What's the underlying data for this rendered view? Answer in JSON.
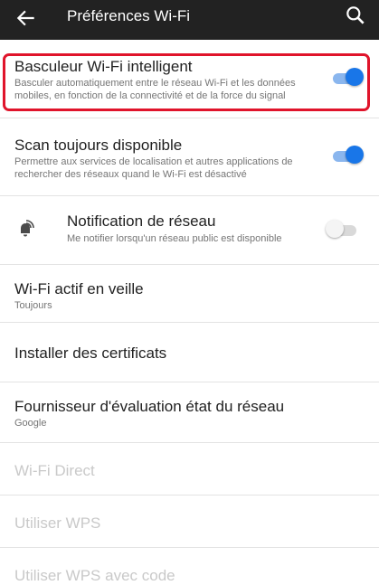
{
  "appbar": {
    "title": "Préférences Wi-Fi",
    "back_icon": "arrow-left-icon",
    "search_icon": "search-icon"
  },
  "colors": {
    "appbar": "#222222",
    "toggle_on": "#1976e8",
    "highlight": "#e0142b",
    "text_primary": "#212121",
    "text_secondary": "#757575",
    "text_disabled": "#c9c9c9"
  },
  "items": [
    {
      "title": "Basculeur Wi-Fi intelligent",
      "subtitle_lines": [
        "Basculer automatiquement entre le réseau Wi-Fi et les données",
        "mobiles, en fonction de la connectivité et de la force du signal"
      ],
      "toggle": "on",
      "highlighted": true
    },
    {
      "title": "Scan toujours disponible",
      "subtitle_lines": [
        "Permettre aux services de localisation et autres applications de",
        "rechercher des réseaux quand le Wi-Fi est désactivé"
      ],
      "toggle": "on"
    },
    {
      "title": "Notification de réseau",
      "subtitle_lines": [
        "Me notifier lorsqu'un réseau public est disponible"
      ],
      "toggle": "off",
      "icon": "wifi-notification-icon"
    },
    {
      "title": "Wi-Fi actif en veille",
      "subtitle_lines": [
        "Toujours"
      ]
    },
    {
      "title": "Installer des certificats"
    },
    {
      "title": "Fournisseur d'évaluation état du réseau",
      "subtitle_lines": [
        "Google"
      ]
    },
    {
      "title": "Wi-Fi Direct",
      "disabled": true
    },
    {
      "title": "Utiliser WPS",
      "disabled": true
    },
    {
      "title": "Utiliser WPS avec code",
      "disabled": true
    }
  ]
}
